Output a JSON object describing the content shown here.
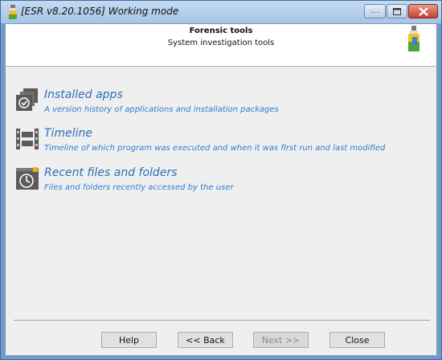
{
  "window": {
    "title": "[ESR v8.20.1056]  Working mode"
  },
  "header": {
    "title": "Forensic tools",
    "subtitle": "System investigation tools"
  },
  "items": [
    {
      "title": "Installed apps",
      "description": "A version history of applications and installation packages",
      "icon": "installed-apps-icon"
    },
    {
      "title": "Timeline",
      "description": "Timeline of which program was executed and when it was first run and last modified",
      "icon": "film-strip-icon"
    },
    {
      "title": "Recent files and folders",
      "description": "Files and folders recently accessed by the user",
      "icon": "clock-icon"
    }
  ],
  "footer": {
    "help": "Help",
    "back": "<< Back",
    "next": "Next >>",
    "close": "Close"
  }
}
